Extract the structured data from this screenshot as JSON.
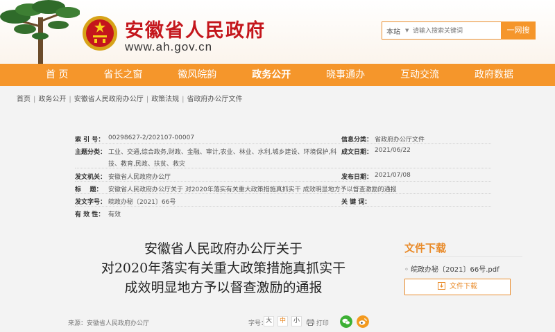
{
  "header": {
    "site_title": "安徽省人民政府",
    "site_url": "www.ah.gov.cn",
    "search": {
      "scope": "本站",
      "placeholder": "请输入搜索关键词",
      "button": "一网搜"
    }
  },
  "nav": {
    "items": [
      "首 页",
      "省长之窗",
      "徽风皖韵",
      "政务公开",
      "晓事通办",
      "互动交流",
      "政府数据"
    ],
    "active_index": 3
  },
  "breadcrumb": [
    "首页",
    "政务公开",
    "安徽省人民政府办公厅",
    "政策法规",
    "省政府办公厅文件"
  ],
  "info": {
    "index_no": {
      "label": "索 引 号：",
      "value": "00298627-2/202107-00007"
    },
    "category": {
      "label": "信息分类：",
      "value": "省政府办公厅文件"
    },
    "subject": {
      "label": "主题分类：",
      "value_line1": "工业、交通,综合政务,财政、金融、审计,农业、林业、水利,城乡建设、环境保护,科",
      "value_line2": "技、教育,民政、扶贫、救灾"
    },
    "created": {
      "label": "成文日期：",
      "value": "2021/06/22"
    },
    "issuer": {
      "label": "发文机关：",
      "value": "安徽省人民政府办公厅"
    },
    "published": {
      "label": "发布日期：",
      "value": "2021/07/08"
    },
    "title": {
      "label": "标    题：",
      "value": "安徽省人民政府办公厅关于 对2020年落实有关重大政策措施真抓实干 成效明显地方予以督查激励的通报"
    },
    "doc_no": {
      "label": "发文字号：",
      "value": "皖政办秘〔2021〕66号"
    },
    "keywords": {
      "label": "关 键 词：",
      "value": ""
    },
    "validity": {
      "label": "有 效 性：",
      "value": "有效"
    }
  },
  "article": {
    "title_lines": [
      "安徽省人民政府办公厅关于",
      "对2020年落实有关重大政策措施真抓实干",
      "成效明显地方予以督查激励的通报"
    ],
    "source": "来源：安徽省人民政府办公厅",
    "font_size_label": "字号：",
    "font_sizes": [
      "大",
      "中",
      "小"
    ],
    "print_label": "打印"
  },
  "downloads": {
    "title": "文件下载",
    "file": "皖政办秘〔2021〕66号.pdf",
    "button": "文件下载"
  },
  "colors": {
    "brand_red": "#c4161c",
    "nav_orange": "#f5962b",
    "accent_orange": "#e98b2a",
    "wechat_green": "#3cb034",
    "weibo_orange": "#f39a1f"
  },
  "icons": [
    "pine-tree",
    "national-emblem-icon",
    "search-caret-icon",
    "printer-icon",
    "wechat-icon",
    "weibo-icon",
    "download-icon"
  ]
}
